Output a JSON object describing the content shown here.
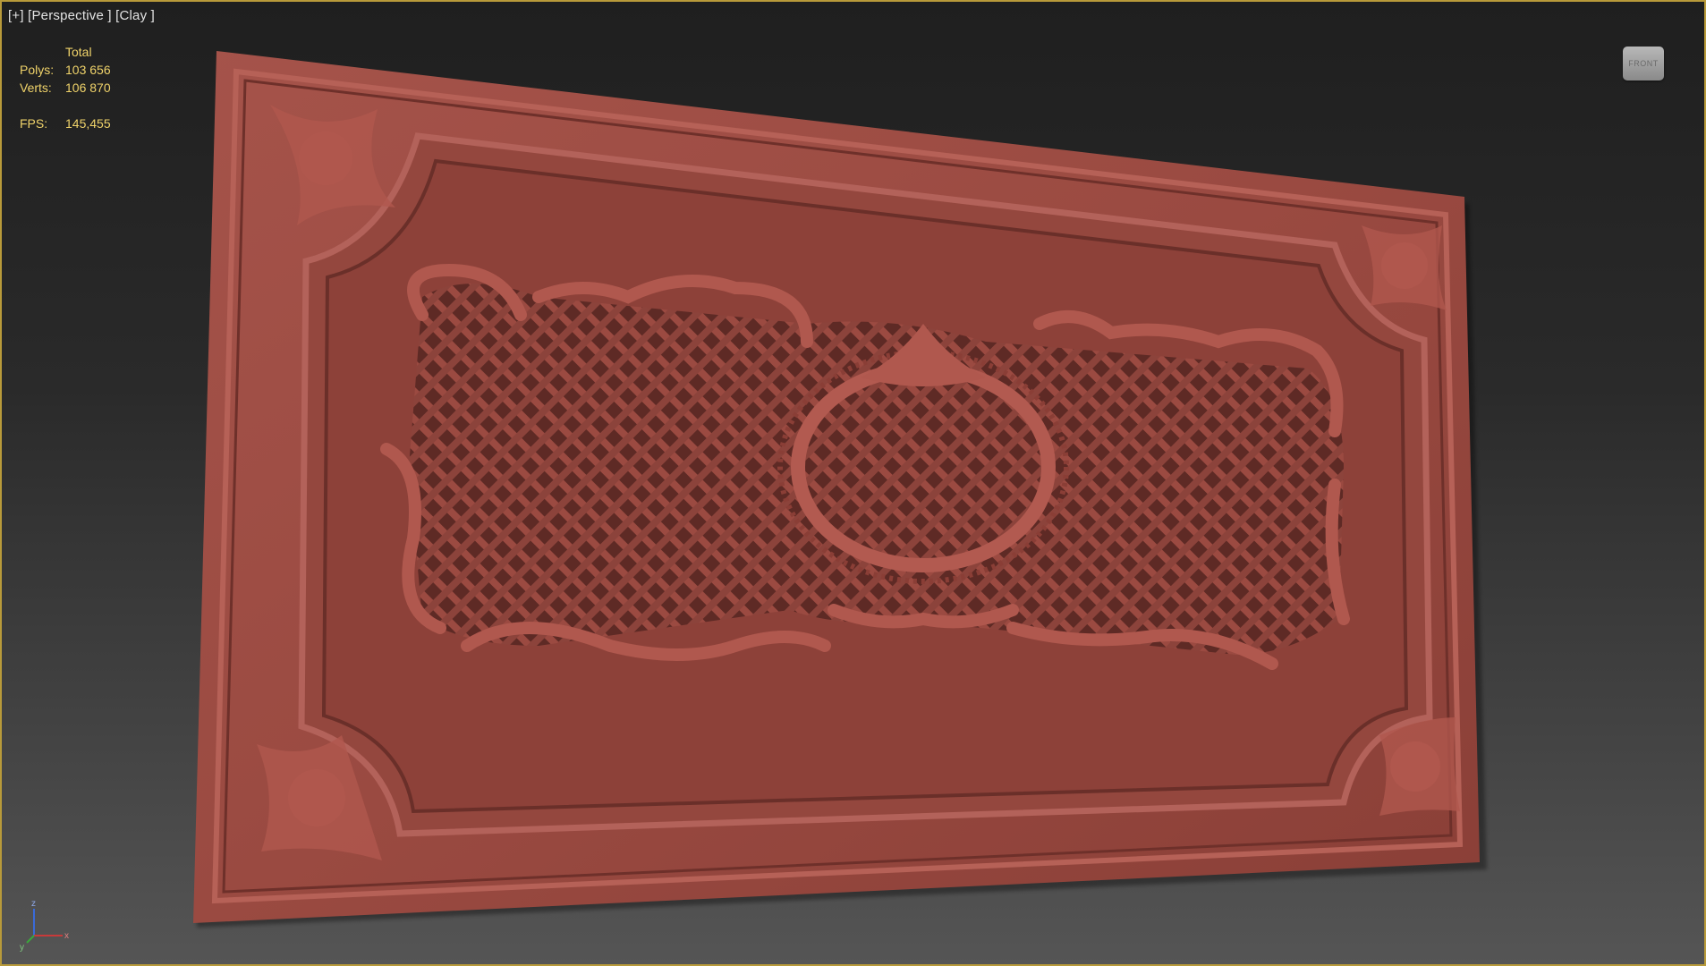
{
  "viewport": {
    "label_plus": "[+]",
    "label_view": "[Perspective ]",
    "label_shading": "[Clay ]",
    "border_color": "#b89a3a"
  },
  "stats": {
    "header": "Total",
    "polys_label": "Polys:",
    "polys_value": "103 656",
    "verts_label": "Verts:",
    "verts_value": "106 870",
    "fps_label": "FPS:",
    "fps_value": "145,455",
    "color": "#f0d36a"
  },
  "viewcube": {
    "label": "FRONT",
    "icon": "viewcube-icon"
  },
  "axis": {
    "z": "z",
    "x": "x",
    "y": "y"
  },
  "model": {
    "name": "ornamental-carved-panel",
    "color": "#9a4a41"
  }
}
